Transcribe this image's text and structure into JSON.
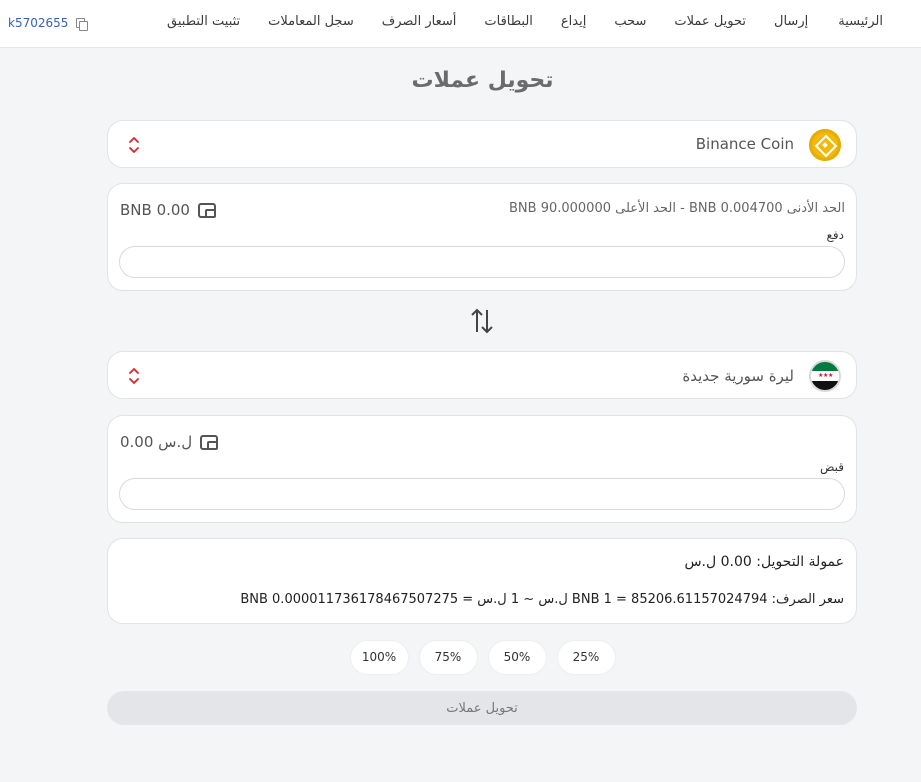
{
  "nav": {
    "items": [
      "الرئيسية",
      "إرسال",
      "تحويل عملات",
      "سحب",
      "إيداع",
      "البطاقات",
      "أسعار الصرف",
      "سجل المعاملات",
      "تثبيت التطبيق"
    ],
    "account_id": "k5702655"
  },
  "page": {
    "title": "تحويل عملات"
  },
  "from": {
    "currency": "Binance Coin",
    "icon": "bnb-coin-icon",
    "balance": "BNB 0.00",
    "limits": "الحد الأدنى  BNB 0.004700  -  الحد الأعلى  BNB 90.000000",
    "label": "دفع",
    "value": "",
    "placeholder": ""
  },
  "to": {
    "currency": "ليرة سورية جديدة",
    "icon": "syria-flag-icon",
    "balance": "0.00 ل.س",
    "label": "قبض",
    "value": "",
    "placeholder": ""
  },
  "info": {
    "commission": "عمولة التحويل: 0.00 ل.س",
    "rate": "سعر الصرف: BNB 1 = 85206.61157024794 ل.س ~ 1 ل.س = BNB 0.000011736178467507275"
  },
  "percent_buttons": [
    "25%",
    "50%",
    "75%",
    "100%"
  ],
  "submit_label": "تحويل عملات",
  "colors": {
    "accent_red": "#d9262c",
    "bnb_yellow": "#f0b90b",
    "link_blue": "#2e64c2"
  }
}
